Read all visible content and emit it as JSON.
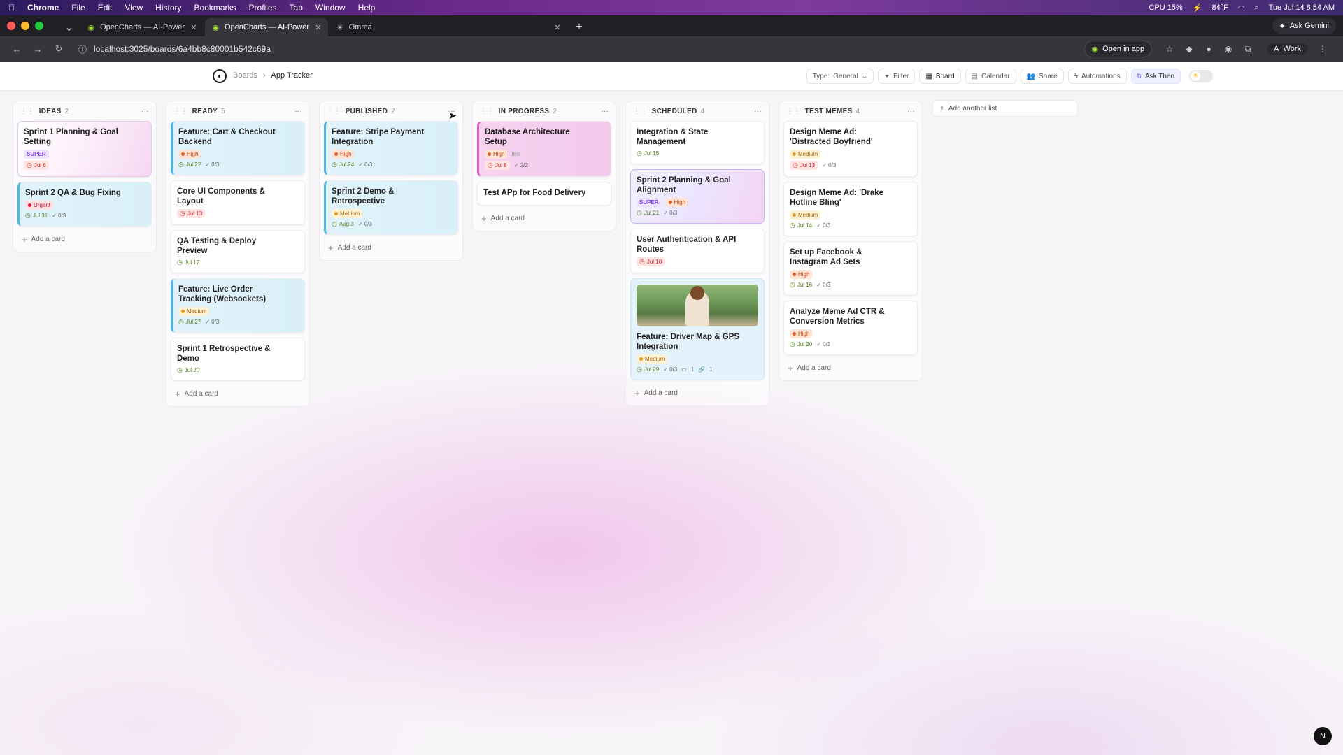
{
  "menubar": {
    "app": "Chrome",
    "items": [
      "File",
      "Edit",
      "View",
      "History",
      "Bookmarks",
      "Profiles",
      "Tab",
      "Window",
      "Help"
    ],
    "status": {
      "cpu": "CPU 15%",
      "weather": "84°F",
      "clock": "Tue Jul 14  8:54 AM"
    }
  },
  "browser": {
    "tabs": [
      {
        "title": "OpenCharts — AI-Powered F"
      },
      {
        "title": "OpenCharts — AI-Powered F"
      },
      {
        "title": "Omma"
      }
    ],
    "ask_gemini": "Ask Gemini",
    "url": "localhost:3025/boards/6a4bb8c80001b542c69a",
    "open_in_app": "Open in app",
    "profile": "Work",
    "profile_initial": "A"
  },
  "app": {
    "breadcrumb": {
      "root": "Boards",
      "current": "App Tracker"
    },
    "toolbar": {
      "type_label": "Type:",
      "type_value": "General",
      "filter": "Filter",
      "board": "Board",
      "calendar": "Calendar",
      "share": "Share",
      "automations": "Automations",
      "ask_theo": "Ask Theo"
    },
    "add_list": "Add another list",
    "add_card": "Add a card",
    "corner_button": "N"
  },
  "lists": [
    {
      "title": "IDEAS",
      "count": "2",
      "cards": [
        {
          "title": "Sprint 1 Planning & Goal Setting",
          "style": "pink",
          "tags": [
            {
              "t": "SUPER",
              "k": "sup"
            }
          ],
          "date": "Jul 6",
          "date_red": true
        },
        {
          "title": "Sprint 2 QA & Bug Fixing",
          "style": "blue",
          "tags": [
            {
              "t": "Urgent",
              "k": "urg"
            }
          ],
          "date": "Jul 31",
          "checks": "0/3"
        }
      ]
    },
    {
      "title": "READY",
      "count": "5",
      "cards": [
        {
          "title": "Feature: Cart & Checkout Backend",
          "style": "blue",
          "tags": [
            {
              "t": "High",
              "k": "high"
            }
          ],
          "date": "Jul 22",
          "checks": "0/3"
        },
        {
          "title": "Core UI Components & Layout",
          "style": "",
          "date": "Jul 13",
          "date_red": true
        },
        {
          "title": "QA Testing & Deploy Preview",
          "style": "",
          "date": "Jul 17"
        },
        {
          "title": "Feature: Live Order Tracking (Websockets)",
          "style": "blue",
          "tags": [
            {
              "t": "Medium",
              "k": "med"
            }
          ],
          "date": "Jul 27",
          "checks": "0/3"
        },
        {
          "title": "Sprint 1 Retrospective & Demo",
          "style": "",
          "date": "Jul 20"
        }
      ]
    },
    {
      "title": "PUBLISHED",
      "count": "2",
      "cards": [
        {
          "title": "Feature: Stripe Payment Integration",
          "style": "blue",
          "tags": [
            {
              "t": "High",
              "k": "high"
            }
          ],
          "date": "Jul 24",
          "checks": "0/3"
        },
        {
          "title": "Sprint 2 Demo & Retrospective",
          "style": "blue",
          "tags": [
            {
              "t": "Medium",
              "k": "med"
            }
          ],
          "date": "Aug 3",
          "checks": "0/3"
        }
      ]
    },
    {
      "title": "IN PROGRESS",
      "count": "2",
      "cards": [
        {
          "title": "Database Architecture Setup",
          "style": "magenta",
          "tags": [
            {
              "t": "High",
              "k": "high"
            },
            {
              "t": "test",
              "k": "plain"
            }
          ],
          "date": "Jul 8",
          "date_red": true,
          "checks": "2/2"
        },
        {
          "title": "Test APp for Food Delivery",
          "style": "",
          "compact": true
        }
      ]
    },
    {
      "title": "SCHEDULED",
      "count": "4",
      "cards": [
        {
          "title": "Integration & State Management",
          "style": "",
          "date": "Jul 15"
        },
        {
          "title": "Sprint 2 Planning & Goal Alignment",
          "style": "purple",
          "tags": [
            {
              "t": "SUPER",
              "k": "sup"
            },
            {
              "t": "High",
              "k": "high"
            }
          ],
          "date": "Jul 21",
          "checks": "0/3"
        },
        {
          "title": "User Authentication & API Routes",
          "style": "",
          "date": "Jul 10",
          "date_red": true
        },
        {
          "title": "Feature: Driver Map & GPS Integration",
          "style": "bluelight",
          "image": true,
          "tags": [
            {
              "t": "Medium",
              "k": "med"
            }
          ],
          "date": "Jul 29",
          "checks": "0/3",
          "comments": "1",
          "links": "1"
        }
      ]
    },
    {
      "title": "TEST MEMES",
      "count": "4",
      "cards": [
        {
          "title": "Design Meme Ad: 'Distracted Boyfriend'",
          "style": "",
          "tags": [
            {
              "t": "Medium",
              "k": "med"
            }
          ],
          "date": "Jul 13",
          "date_red": true,
          "checks": "0/3"
        },
        {
          "title": "Design Meme Ad: 'Drake Hotline Bling'",
          "style": "",
          "tags": [
            {
              "t": "Medium",
              "k": "med"
            }
          ],
          "date": "Jul 14",
          "checks": "0/3"
        },
        {
          "title": "Set up Facebook & Instagram Ad Sets",
          "style": "",
          "tags": [
            {
              "t": "High",
              "k": "high"
            }
          ],
          "date": "Jul 16",
          "checks": "0/3"
        },
        {
          "title": "Analyze Meme Ad CTR & Conversion Metrics",
          "style": "",
          "tags": [
            {
              "t": "High",
              "k": "high"
            }
          ],
          "date": "Jul 20",
          "checks": "0/3"
        }
      ]
    }
  ]
}
